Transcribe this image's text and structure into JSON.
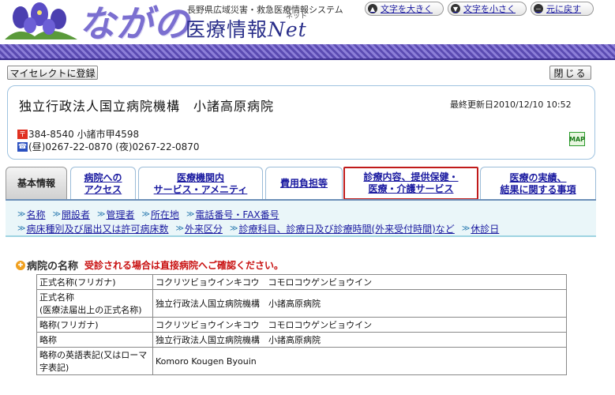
{
  "header": {
    "logo_text": "ながの",
    "system_name": "長野県広域災害・救急医療情報システム",
    "site_title": "医療情報",
    "site_title_suffix": "Net",
    "net_ruby": "ネット",
    "buttons": {
      "text_larger": "文字を大きく",
      "text_smaller": "文字を小さく",
      "back": "元に戻す"
    }
  },
  "actions": {
    "myselect": "マイセレクトに登録",
    "close": "閉じる"
  },
  "hospital": {
    "name": "独立行政法人国立病院機構　小諸高原病院",
    "last_updated_label": "最終更新日",
    "last_updated": "2010/12/10 10:52",
    "postal_icon": "〒",
    "postal_address": "384-8540 小諸市甲4598",
    "phone_icon": "☎",
    "phone": "(昼)0267-22-0870 (夜)0267-22-0870",
    "map_label": "MAP"
  },
  "tabs": [
    {
      "line1": "基本情報",
      "line2": ""
    },
    {
      "line1": "病院への",
      "line2": "アクセス"
    },
    {
      "line1": "医療機関内",
      "line2": "サービス・アメニティ"
    },
    {
      "line1": "費用負担等",
      "line2": ""
    },
    {
      "line1": "診療内容、提供保健・",
      "line2": "医療・介護サービス"
    },
    {
      "line1": "医療の実績、",
      "line2": "結果に関する事項"
    }
  ],
  "subnav": {
    "row1": [
      "名称",
      "開設者",
      "管理者",
      "所在地",
      "電話番号・FAX番号"
    ],
    "row2": [
      "病床種別及び届出又は許可病床数",
      "外来区分",
      "診療科目、診療日及び診療時間(外来受付時間)など",
      "休診日"
    ]
  },
  "section": {
    "title": "病院の名称",
    "note": "受診される場合は直接病院へご確認ください。"
  },
  "table_rows": [
    {
      "label": "正式名称(フリガナ)",
      "value": "コクリツビョウインキコウ　コモロコウゲンビョウイン"
    },
    {
      "label": "正式名称\n(医療法届出上の正式名称)",
      "value": "独立行政法人国立病院機構　小諸高原病院"
    },
    {
      "label": "略称(フリガナ)",
      "value": "コクリツビョウインキコウ　コモロコウゲンビョウイン"
    },
    {
      "label": "略称",
      "value": "独立行政法人国立病院機構　小諸高原病院"
    },
    {
      "label": "略称の英語表記(又はローマ字表記)",
      "value": "Komoro Kougen Byouin"
    }
  ],
  "colors": {
    "brand_purple": "#7b6fd0",
    "title_blue": "#2a2f8a",
    "link_blue": "#1a1aa0",
    "alert_red": "#c81010"
  }
}
